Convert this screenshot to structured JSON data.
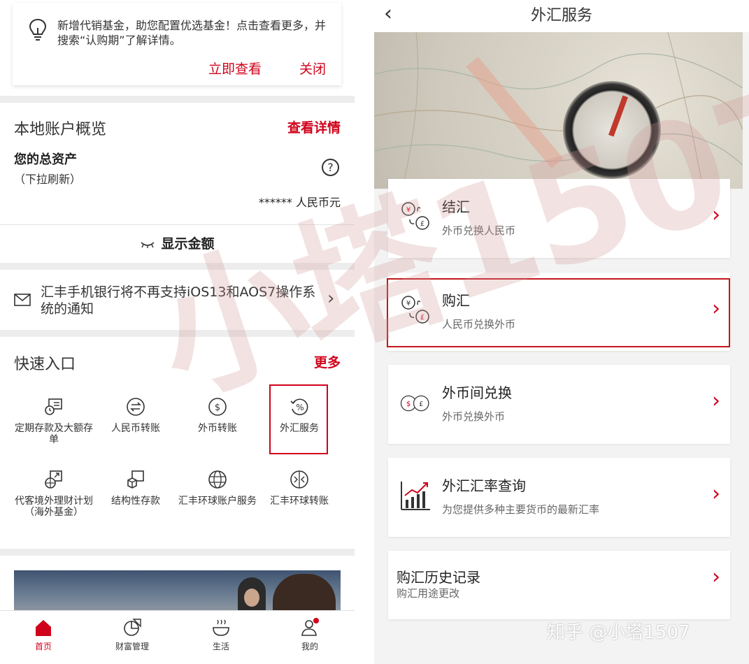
{
  "left": {
    "notice": {
      "text": "新增代销基金，助您配置优选基金！点击查看更多，并搜索“认购期”了解详情。",
      "view_label": "立即查看",
      "close_label": "关闭"
    },
    "account": {
      "title": "本地账户概览",
      "details_label": "查看详情",
      "assets_label": "您的总资产",
      "refresh_hint": "（下拉刷新）",
      "help_glyph": "?",
      "masked_value": "****** 人民币元",
      "show_amount_label": "显示金额"
    },
    "system_notice": {
      "text": "汇丰手机银行将不再支持iOS13和AOS7操作系统的通知"
    },
    "quick": {
      "title": "快速入口",
      "more_label": "更多",
      "items": [
        {
          "label": "定期存款及大额存单",
          "icon": "term-deposit-icon"
        },
        {
          "label": "人民币转账",
          "icon": "rmb-transfer-icon"
        },
        {
          "label": "外币转账",
          "icon": "fx-transfer-icon"
        },
        {
          "label": "外汇服务",
          "icon": "fx-service-icon"
        },
        {
          "label": "代客境外理财计划（海外基金）",
          "icon": "qdii-icon"
        },
        {
          "label": "结构性存款",
          "icon": "structured-deposit-icon"
        },
        {
          "label": "汇丰环球账户服务",
          "icon": "global-account-icon"
        },
        {
          "label": "汇丰环球转账",
          "icon": "global-transfer-icon"
        }
      ]
    },
    "tabs": [
      {
        "label": "首页",
        "icon": "home-icon"
      },
      {
        "label": "财富管理",
        "icon": "wealth-icon"
      },
      {
        "label": "生活",
        "icon": "life-icon"
      },
      {
        "label": "我的",
        "icon": "profile-icon"
      }
    ]
  },
  "right": {
    "title": "外汇服务",
    "back_glyph": "‹",
    "items": [
      {
        "title": "结汇",
        "subtitle": "外币兑换人民币"
      },
      {
        "title": "购汇",
        "subtitle": "人民币兑换外币"
      },
      {
        "title": "外币间兑换",
        "subtitle": "外币兑换外币"
      },
      {
        "title": "外汇汇率查询",
        "subtitle": "为您提供多种主要货币的最新汇率"
      },
      {
        "title": "购汇历史记录",
        "subtitle": "购汇用途更改"
      }
    ]
  },
  "watermark": {
    "corner": "知乎 @小塔1507",
    "big": "小塔1507"
  },
  "colors": {
    "accent": "#d0021b",
    "highlight_box": "#c4161c"
  }
}
